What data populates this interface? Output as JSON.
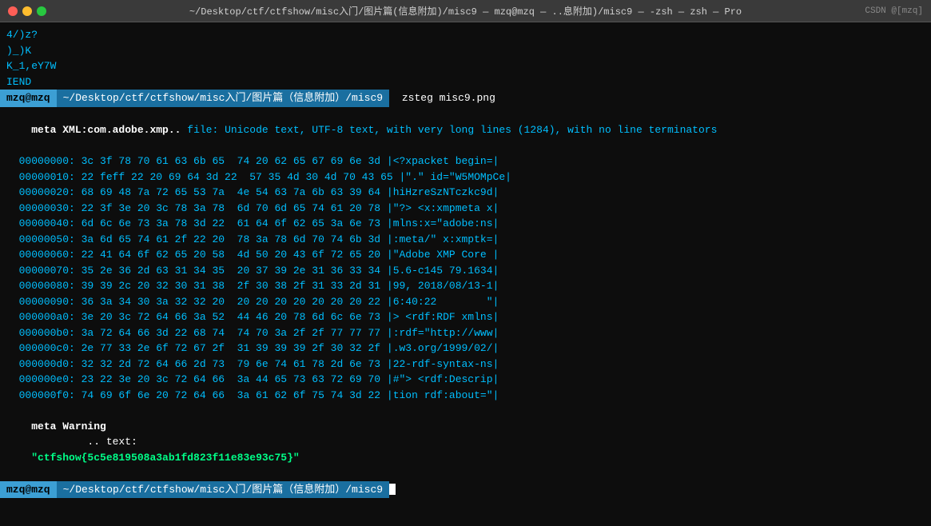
{
  "titleBar": {
    "title": "~/Desktop/ctf/ctfshow/misc入门/图片篇(信息附加)/misc9 — mzq@mzq — ..息附加)/misc9 — -zsh — zsh — Pro",
    "csdn": "CSDN @[mzq]"
  },
  "terminal": {
    "preLines": [
      {
        "text": "4/)z?",
        "color": "cyan"
      },
      {
        "text": ")_)K",
        "color": "cyan"
      },
      {
        "text": "K_1,eY7W",
        "color": "cyan"
      },
      {
        "text": "IEND",
        "color": "cyan"
      }
    ],
    "prompt1": {
      "user": "mzq@mzq",
      "path": "~/Desktop/ctf/ctfshow/misc入门/图片篇（信息附加）/misc9",
      "cmd": " zsteg misc9.png"
    },
    "metaLine": "meta XML:com.adobe.xmp.. file: Unicode text, UTF-8 text, with very long lines (1284), with no line terminators",
    "hexLines": [
      {
        "addr": "00000000:",
        "bytes": "3c 3f 78 70 61 63 6b 65  74 20 62 65 67 69 6e 3d",
        "ascii": "|<?xpacket begin=|"
      },
      {
        "addr": "00000010:",
        "bytes": "22 feff 22 20 69 64 3d 22  57 35 4d 30 4d 70 43 65",
        "ascii": "|\".\" id=\"W5MOMpCe|"
      },
      {
        "addr": "00000020:",
        "bytes": "68 69 48 7a 72 65 53 7a  4e 54 63 7a 6b 63 39 64",
        "ascii": "|hiHzreSzNTczkc9d|"
      },
      {
        "addr": "00000030:",
        "bytes": "22 3f 3e 20 3c 78 3a 78  6d 70 6d 65 74 61 20 78",
        "ascii": "|\"?> <x:xmpmeta x|"
      },
      {
        "addr": "00000040:",
        "bytes": "6d 6c 6e 73 3a 78 3d 22  61 64 6f 62 65 3a 6e 73",
        "ascii": "|mlns:x=\"adobe:ns|"
      },
      {
        "addr": "00000050:",
        "bytes": "3a 6d 65 74 61 2f 22 20  78 3a 78 6d 70 74 6b 3d",
        "ascii": "|:meta/\" x:xmptk=|"
      },
      {
        "addr": "00000060:",
        "bytes": "22 41 64 6f 62 65 20 58  4d 50 20 43 6f 72 65 20",
        "ascii": "|\"Adobe XMP Core |"
      },
      {
        "addr": "00000070:",
        "bytes": "35 2e 36 2d 63 31 34 35  20 37 39 2e 31 36 33 34",
        "ascii": "|5.6-c145 79.1634|"
      },
      {
        "addr": "00000080:",
        "bytes": "39 39 2c 20 32 30 31 38  2f 30 38 2f 31 33 2d 31",
        "ascii": "|99, 2018/08/13-1|"
      },
      {
        "addr": "00000090:",
        "bytes": "36 3a 34 30 3a 32 32 20  20 20 20 20 20 20 20 22",
        "ascii": "|6:40:22        \"|"
      },
      {
        "addr": "000000a0:",
        "bytes": "3e 20 3c 72 64 66 3a 52  44 46 20 78 6d 6c 6e 73",
        "ascii": "|> <rdf:RDF xmlns|"
      },
      {
        "addr": "000000b0:",
        "bytes": "3a 72 64 66 3d 22 68 74  74 70 3a 2f 2f 77 77 77",
        "ascii": "|:rdf=\"http://www|"
      },
      {
        "addr": "000000c0:",
        "bytes": "2e 77 33 2e 6f 72 67 2f  31 39 39 39 2f 30 32 2f",
        "ascii": "|.w3.org/1999/02/|"
      },
      {
        "addr": "000000d0:",
        "bytes": "32 32 2d 72 64 66 2d 73  79 6e 74 61 78 2d 6e 73",
        "ascii": "|22-rdf-syntax-ns|"
      },
      {
        "addr": "000000e0:",
        "bytes": "23 22 3e 20 3c 72 64 66  3a 44 65 73 63 72 69 70",
        "ascii": "|#\"> <rdf:Descrip|"
      },
      {
        "addr": "000000f0:",
        "bytes": "74 69 6f 6e 20 72 64 66  3a 61 62 6f 75 74 3d 22",
        "ascii": "|tion rdf:about=\"|"
      }
    ],
    "warningLine": {
      "prefix": "meta Warning",
      "middle": ".. text: ",
      "flag": "\"ctfshow{5c5e819508a3ab1fd823f11e83e93c75}\""
    },
    "prompt2": {
      "user": "mzq@mzq",
      "path": "~/Desktop/ctf/ctfshow/misc入门/图片篇（信息附加）/misc9"
    }
  }
}
